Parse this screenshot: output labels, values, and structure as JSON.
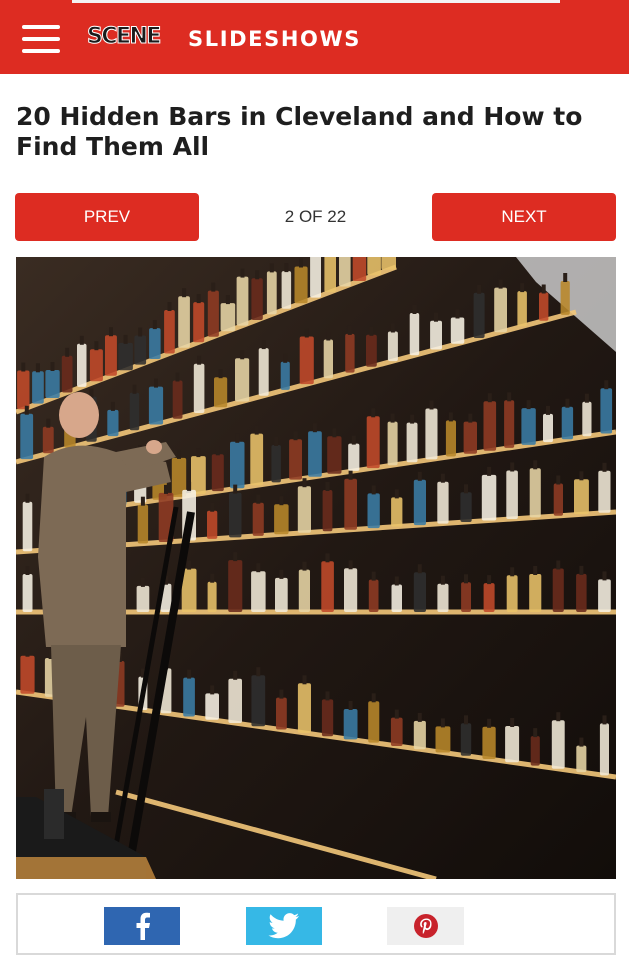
{
  "header": {
    "logo": "SCENE",
    "section": "SLIDESHOWS",
    "menu_icon": "hamburger-icon",
    "accent_color": "#dd2c22"
  },
  "article": {
    "title": "20 Hidden Bars in Cleveland and How to Find Them All"
  },
  "pager": {
    "prev_label": "PREV",
    "counter": "2 OF 22",
    "next_label": "NEXT",
    "current": 2,
    "total": 22
  },
  "slide": {
    "image": "photo"
  },
  "share": {
    "buttons": [
      {
        "network": "facebook",
        "icon": "facebook-icon",
        "color": "#2f66b1"
      },
      {
        "network": "twitter",
        "icon": "twitter-icon",
        "color": "#36b8e6"
      },
      {
        "network": "pinterest",
        "icon": "pinterest-icon",
        "color": "#efefef"
      }
    ]
  }
}
